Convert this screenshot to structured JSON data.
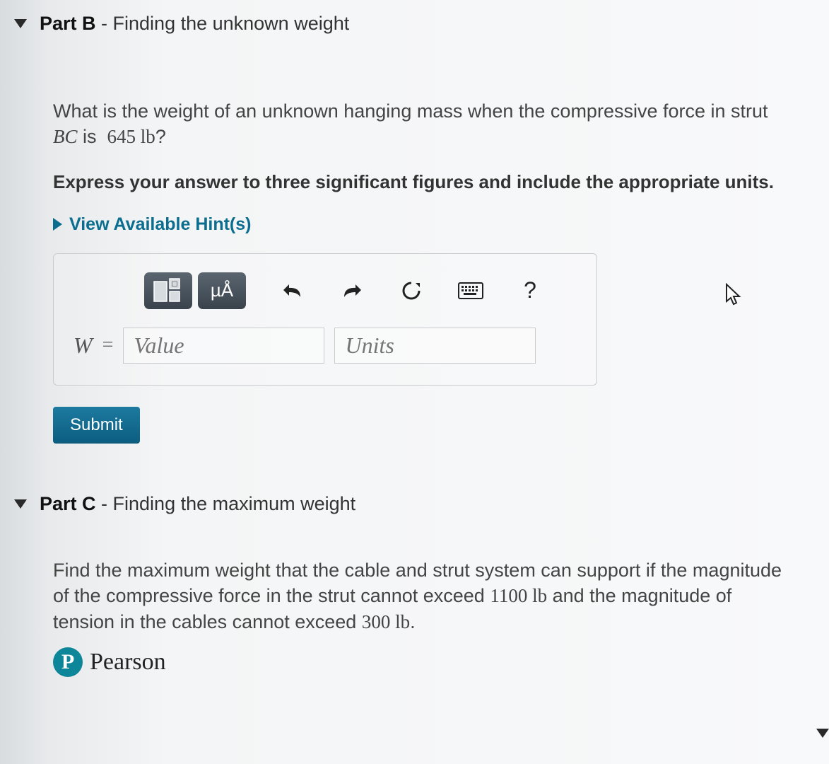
{
  "partB": {
    "label_bold": "Part B",
    "label_rest": " - Finding the unknown weight",
    "question_prefix": "What is the weight of an unknown hanging mass when the compressive force in strut ",
    "strut_name": "BC",
    "question_mid": " is ",
    "force_value": "645 lb",
    "question_suffix": "?",
    "instruction": "Express your answer to three significant figures and include the appropriate units.",
    "hints_label": "View Available Hint(s)"
  },
  "answer": {
    "variable": "W",
    "equals": "=",
    "value_placeholder": "Value",
    "units_placeholder": "Units",
    "submit_label": "Submit"
  },
  "toolbar": {
    "templates_icon": "templates-icon",
    "symbols_label": "µÅ",
    "undo_icon": "undo-icon",
    "redo_icon": "redo-icon",
    "reset_icon": "reset-icon",
    "keyboard_icon": "keyboard-icon",
    "help_label": "?"
  },
  "partC": {
    "label_bold": "Part C",
    "label_rest": " - Finding the maximum weight",
    "question_prefix": "Find the maximum weight that the cable and strut system can support if the magnitude of the compressive force in the strut cannot exceed ",
    "strut_limit": "1100 lb",
    "question_mid": " and the magnitude of tension in the cables cannot exceed ",
    "cable_limit": "300 lb",
    "question_suffix": "."
  },
  "footer": {
    "logo_letter": "P",
    "brand": "Pearson"
  }
}
